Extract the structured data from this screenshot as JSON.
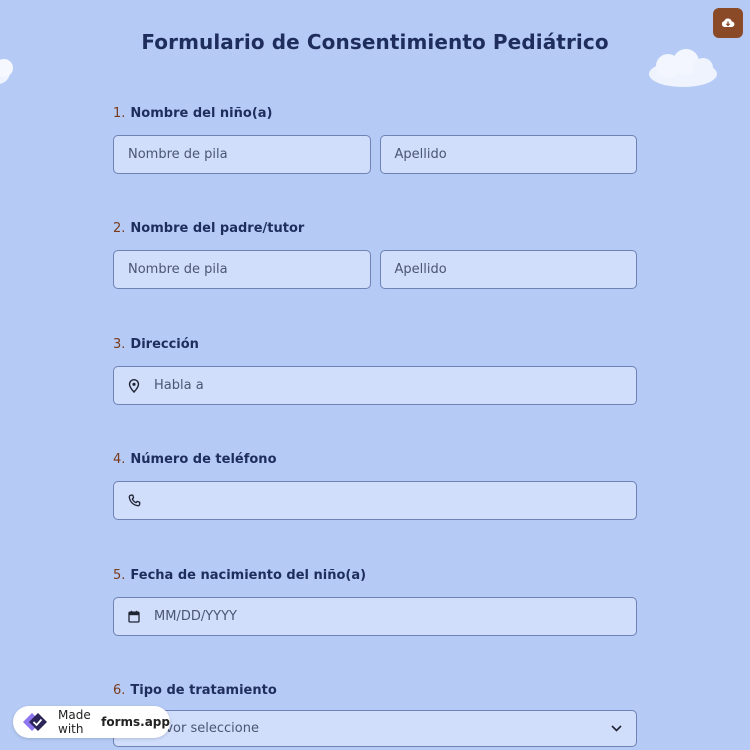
{
  "form": {
    "title": "Formulario de Consentimiento Pediátrico",
    "questions": [
      {
        "number": "1.",
        "label": "Nombre del niño(a)",
        "first_placeholder": "Nombre de pila",
        "last_placeholder": "Apellido"
      },
      {
        "number": "2.",
        "label": "Nombre del padre/tutor",
        "first_placeholder": "Nombre de pila",
        "last_placeholder": "Apellido"
      },
      {
        "number": "3.",
        "label": "Dirección",
        "placeholder": "Habla a"
      },
      {
        "number": "4.",
        "label": "Número de teléfono",
        "placeholder": ""
      },
      {
        "number": "5.",
        "label": "Fecha de nacimiento del niño(a)",
        "placeholder": "MM/DD/YYYY"
      },
      {
        "number": "6.",
        "label": "Tipo de tratamiento",
        "placeholder": "Por favor seleccione"
      }
    ]
  },
  "badge": {
    "made_with": "Made with",
    "brand": "forms.app"
  },
  "colors": {
    "background": "#b5cbf5",
    "field": "#d0ddfb",
    "accent": "#7a3a1c",
    "title": "#1f2d5c",
    "corner_button": "#8a4a28"
  },
  "icons": {
    "corner": "cloud-download-icon",
    "address": "map-pin-icon",
    "phone": "phone-icon",
    "date": "calendar-icon",
    "select": "chevron-down-icon"
  }
}
